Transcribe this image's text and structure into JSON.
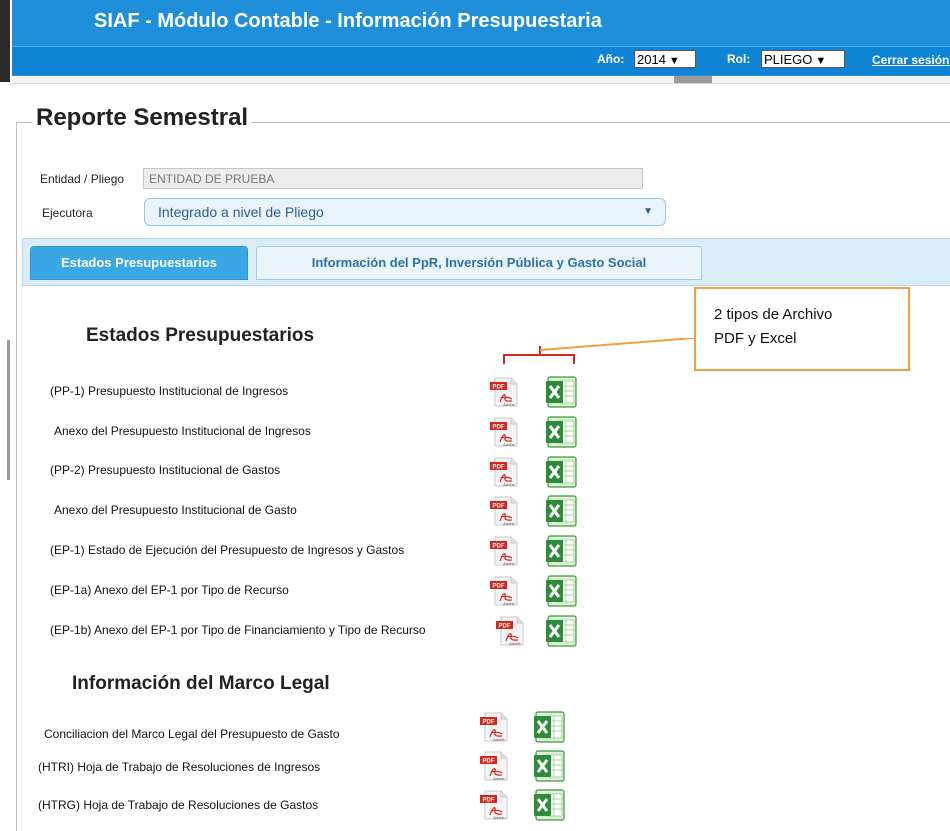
{
  "header": {
    "title": "SIAF - Módulo Contable - Información Presupuestaria",
    "year_label": "Año:",
    "year_value": "2014",
    "role_label": "Rol:",
    "role_value": "PLIEGO",
    "logout_label": "Cerrar sesión"
  },
  "form": {
    "legend": "Reporte Semestral",
    "entidad_label": "Entidad / Pliego",
    "entidad_value": "ENTIDAD DE PRUEBA",
    "ejecutora_label": "Ejecutora",
    "ejecutora_value": "Integrado a nivel de Pliego"
  },
  "tabs": [
    {
      "label": "Estados Presupuestarios",
      "active": true
    },
    {
      "label": "Información del PpR, Inversión Pública y Gasto Social",
      "active": false
    }
  ],
  "estados": {
    "title": "Estados Presupuestarios",
    "items": [
      "(PP-1) Presupuesto Institucional de Ingresos",
      "Anexo del Presupuesto Institucional de Ingresos",
      "(PP-2) Presupuesto Institucional de Gastos",
      "Anexo del Presupuesto Institucional de Gasto",
      "(EP-1) Estado de Ejecución del Presupuesto de Ingresos y Gastos",
      "(EP-1a) Anexo del EP-1 por Tipo de Recurso",
      "(EP-1b) Anexo del EP-1 por Tipo de Financiamiento y Tipo de Recurso"
    ]
  },
  "marco": {
    "title": "Información del Marco Legal",
    "items": [
      "Conciliacion del Marco Legal del Presupuesto de Gasto",
      "(HTRI) Hoja de Trabajo de Resoluciones de Ingresos",
      "(HTRG) Hoja de Trabajo de Resoluciones de Gastos"
    ]
  },
  "callout": {
    "line1": "2 tipos de Archivo",
    "line2": "PDF y Excel"
  },
  "icons": {
    "pdf": "pdf-file-icon",
    "excel": "excel-file-icon"
  },
  "colors": {
    "header_bg": "#1e8fd8",
    "tab_active": "#39a7e6",
    "callout_border": "#f0a040",
    "bracket": "#d9261c",
    "excel_green": "#3c9a3c",
    "pdf_red": "#d9261c"
  }
}
